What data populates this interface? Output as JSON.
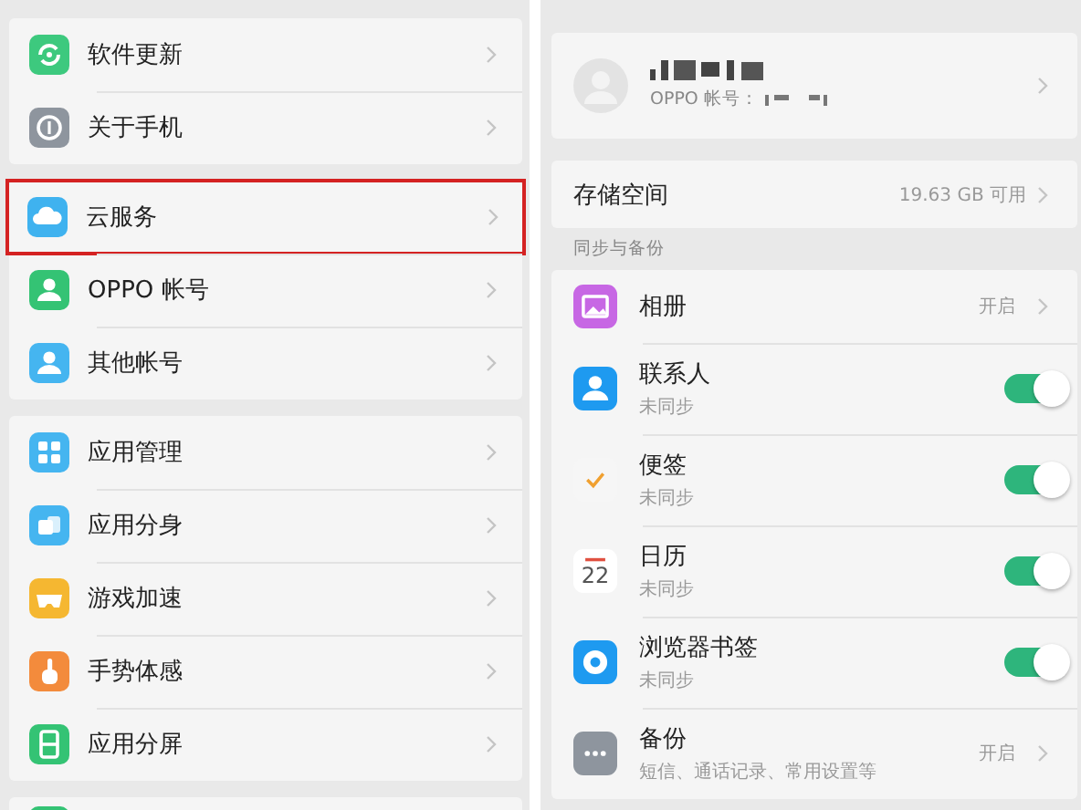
{
  "settings_panel": {
    "groups": [
      {
        "items": [
          {
            "kind": "refresh",
            "label": "软件更新",
            "highlighted": false
          },
          {
            "kind": "info",
            "label": "关于手机",
            "highlighted": false
          }
        ]
      },
      {
        "items": [
          {
            "kind": "cloud",
            "label": "云服务",
            "highlighted": true
          },
          {
            "kind": "person",
            "label": "OPPO 帐号",
            "highlighted": false
          },
          {
            "kind": "person2",
            "label": "其他帐号",
            "highlighted": false
          }
        ]
      },
      {
        "items": [
          {
            "kind": "grid",
            "label": "应用管理",
            "highlighted": false
          },
          {
            "kind": "clone",
            "label": "应用分身",
            "highlighted": false
          },
          {
            "kind": "game",
            "label": "游戏加速",
            "highlighted": false
          },
          {
            "kind": "hand",
            "label": "手势体感",
            "highlighted": false
          },
          {
            "kind": "split",
            "label": "应用分屏",
            "highlighted": false
          }
        ]
      },
      {
        "items": [
          {
            "kind": "partial",
            "highlighted": false
          }
        ]
      }
    ]
  },
  "cloud_panel": {
    "profile": {
      "account_label": "OPPO 帐号："
    },
    "storage": {
      "label": "存储空间",
      "value": "19.63 GB 可用"
    },
    "section_title": "同步与备份",
    "items": [
      {
        "kind": "album",
        "title": "相册",
        "status": "开启"
      },
      {
        "kind": "contacts",
        "title": "联系人",
        "subtitle": "未同步",
        "on": true
      },
      {
        "kind": "notes",
        "title": "便签",
        "subtitle": "未同步",
        "on": true
      },
      {
        "kind": "calendar",
        "title": "日历",
        "subtitle": "未同步",
        "on": true,
        "icon_day": "22"
      },
      {
        "kind": "browser",
        "title": "浏览器书签",
        "subtitle": "未同步",
        "on": true
      },
      {
        "kind": "backup",
        "title": "备份",
        "subtitle": "短信、通话记录、常用设置等",
        "status": "开启"
      }
    ]
  }
}
